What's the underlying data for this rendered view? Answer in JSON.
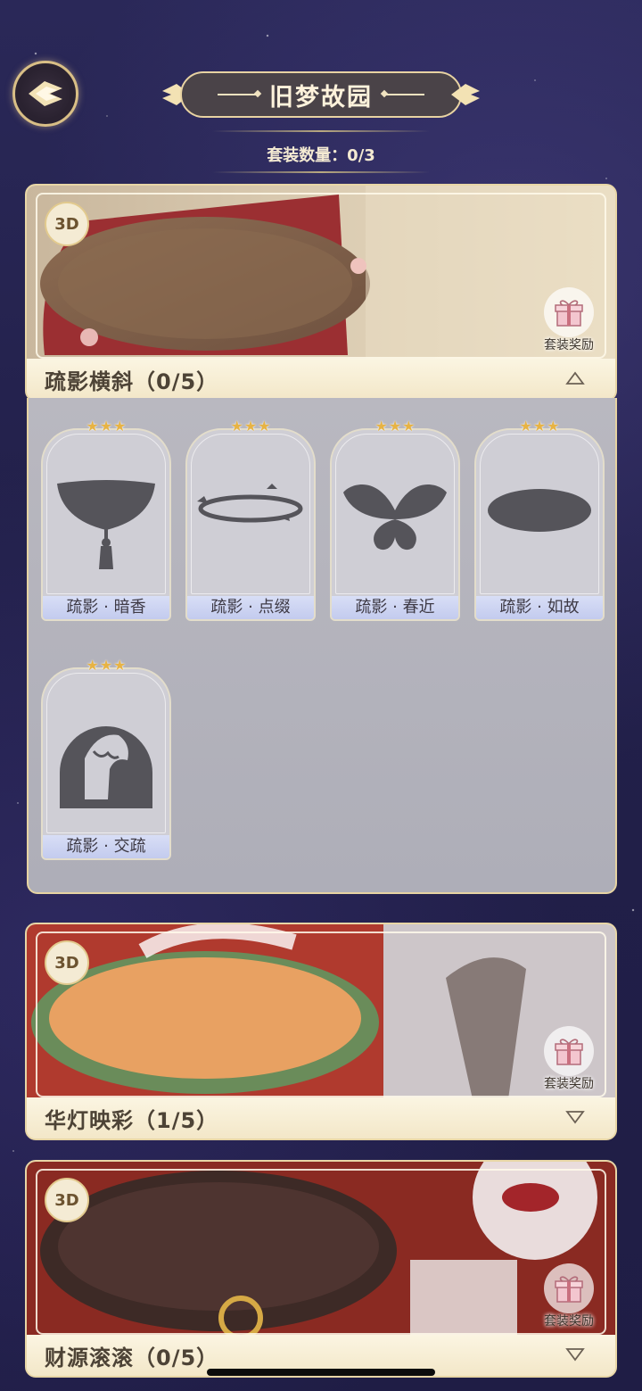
{
  "header": {
    "title": "旧梦故园",
    "set_count_label": "套装数量：0/3"
  },
  "suits": [
    {
      "name": "疏影横斜（0/5）",
      "badge": "3D",
      "reward_label": "套装奖励",
      "expanded": true
    },
    {
      "name": "华灯映彩（1/5）",
      "badge": "3D",
      "reward_label": "套装奖励",
      "expanded": false
    },
    {
      "name": "财源滚滚（0/5）",
      "badge": "3D",
      "reward_label": "套装奖励",
      "expanded": false
    }
  ],
  "items": [
    {
      "name": "疏影 · 暗香",
      "stars": 3,
      "icon": "bowl-tassel-icon"
    },
    {
      "name": "疏影 · 点缀",
      "stars": 3,
      "icon": "ring-leaves-icon"
    },
    {
      "name": "疏影 · 春近",
      "stars": 3,
      "icon": "butterfly-icon"
    },
    {
      "name": "疏影 · 如故",
      "stars": 3,
      "icon": "oval-disc-icon"
    },
    {
      "name": "疏影 · 交疏",
      "stars": 3,
      "icon": "dome-window-icon"
    }
  ],
  "colors": {
    "accent_gold": "#e8d6a6",
    "star": "#e7b344",
    "silhouette": "#55545a"
  }
}
